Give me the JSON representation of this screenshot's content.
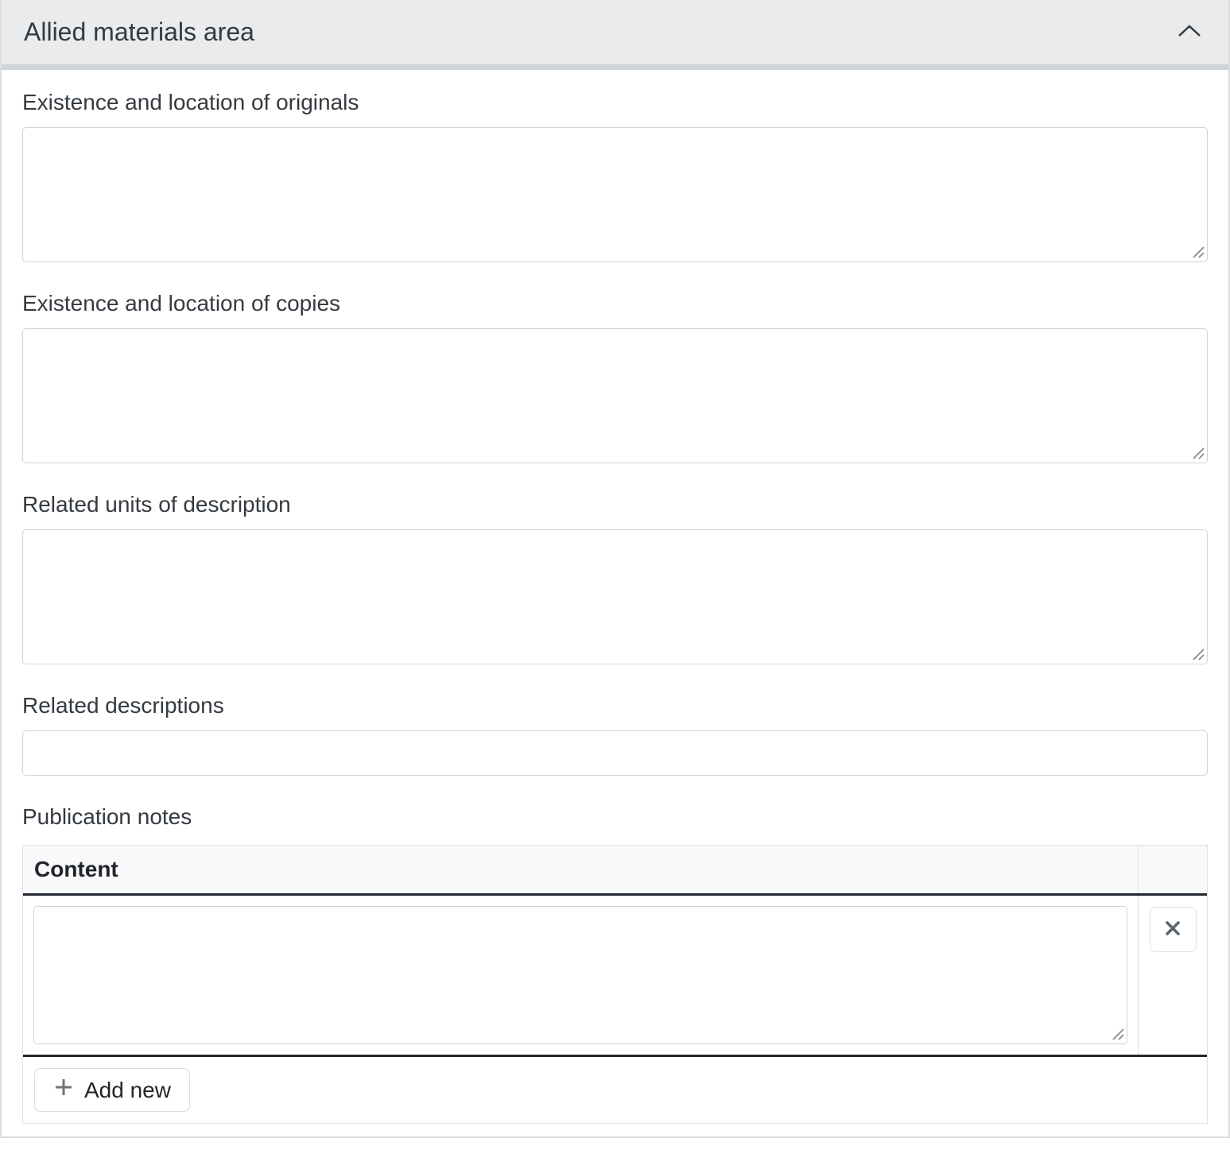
{
  "section": {
    "title": "Allied materials area",
    "collapse_icon": "chevron-up-icon",
    "collapsed": false
  },
  "fields": [
    {
      "label": "Existence and location of originals",
      "type": "textarea",
      "value": "",
      "placeholder": ""
    },
    {
      "label": "Existence and location of copies",
      "type": "textarea",
      "value": "",
      "placeholder": ""
    },
    {
      "label": "Related units of description",
      "type": "textarea",
      "value": "",
      "placeholder": ""
    },
    {
      "label": "Related descriptions",
      "type": "text",
      "value": "",
      "placeholder": ""
    }
  ],
  "publication_notes": {
    "label": "Publication notes",
    "table": {
      "columns": [
        "Content"
      ],
      "rows": [
        {
          "content_value": "",
          "content_placeholder": "",
          "delete_icon": "x-icon"
        }
      ],
      "add_new_label": "Add new",
      "add_new_icon": "plus-icon"
    }
  },
  "colors": {
    "header_bg": "#e9ebed",
    "header_border": "#cfd4d9",
    "section_border": "#d9dce0",
    "text": "#343a40",
    "input_border": "#ced4da",
    "table_header_bg": "#f8f9fa",
    "table_dark_border": "#212831",
    "table_light_border": "#dee2e6",
    "icon_gray": "#6c757d"
  }
}
